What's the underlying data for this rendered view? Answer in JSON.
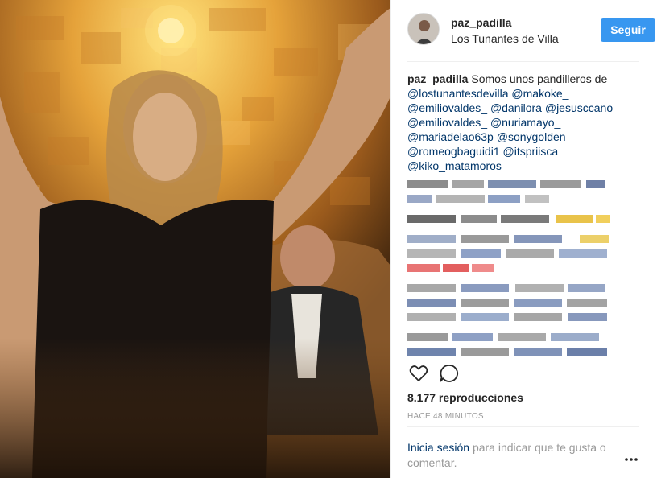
{
  "post": {
    "username": "paz_padilla",
    "location": "Los Tunantes de Villa",
    "follow_label": "Seguir",
    "caption_text": "Somos unos pandilleros de",
    "mentions": [
      "@lostunantesdevilla",
      "@makoke_",
      "@emiliovaldes_",
      "@danilora",
      "@jesusccano",
      "@emiliovaldes_",
      "@nuriamayo_",
      "@mariadelao63p",
      "@sonygolden",
      "@romeogbaguidi1",
      "@itspriisca",
      "@kiko_matamoros"
    ],
    "views": "8.177 reproducciones",
    "time_ago": "HACE 48 MINUTOS"
  },
  "footer": {
    "login_link": "Inicia sesión",
    "login_rest": "para indicar que te gusta o comentar."
  },
  "icons": {
    "like": "heart-icon",
    "comment": "comment-icon",
    "more": "more-options-icon"
  },
  "colors": {
    "follow_button": "#3897f0",
    "mention": "#003569",
    "muted": "#999999",
    "text": "#262626"
  }
}
